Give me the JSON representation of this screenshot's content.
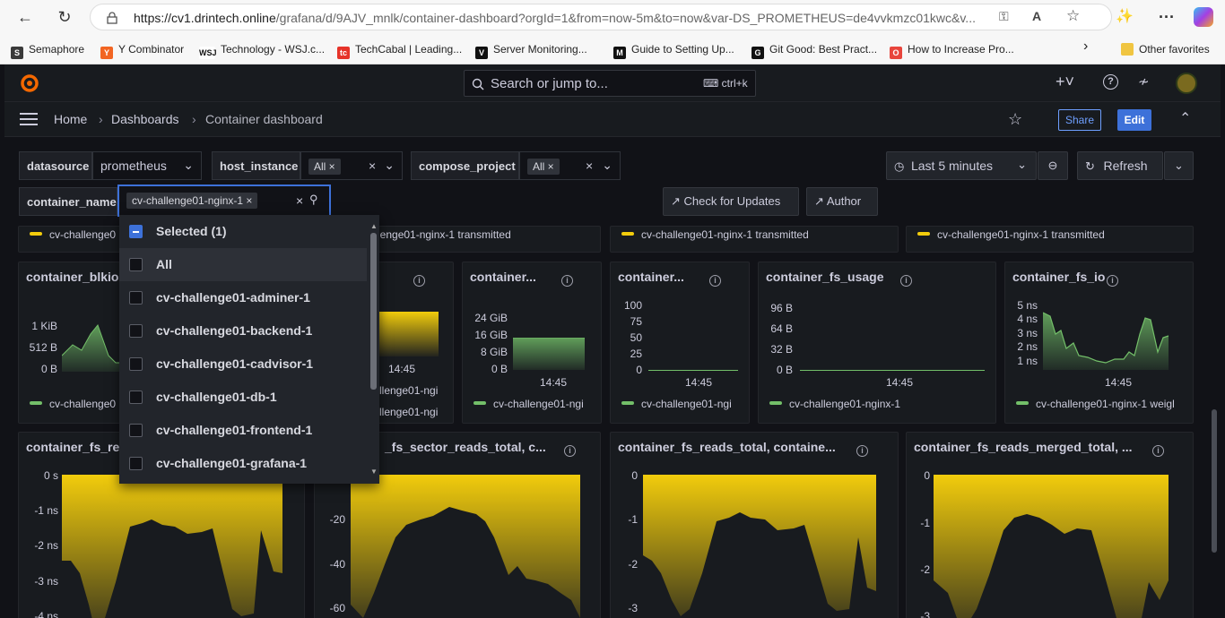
{
  "browser": {
    "url_host": "https://cv1.drintech.online",
    "url_rest": "/grafana/d/9AJV_mnlk/container-dashboard?orgId=1&from=now-5m&to=now&var-DS_PROMETHEUS=de4vvkmzc01kwc&v...",
    "bookmarks": [
      {
        "label": "Semaphore",
        "color": "#3a3a3a",
        "glyph": "S"
      },
      {
        "label": "Y Combinator",
        "color": "#f26522",
        "glyph": "Y"
      },
      {
        "label": "Technology - WSJ.c...",
        "color": "#111111",
        "glyph": "W"
      },
      {
        "label": "TechCabal | Leading...",
        "color": "#e63329",
        "glyph": "tc"
      },
      {
        "label": "Server Monitoring...",
        "color": "#111111",
        "glyph": "V"
      },
      {
        "label": "Guide to Setting Up...",
        "color": "#111111",
        "glyph": "M"
      },
      {
        "label": "Git Good: Best Pract...",
        "color": "#111111",
        "glyph": "G"
      },
      {
        "label": "How to Increase Pro...",
        "color": "#e8453c",
        "glyph": "O"
      }
    ],
    "other_favorites": "Other favorites"
  },
  "topbar": {
    "search_placeholder": "Search or jump to...",
    "shortcut": "ctrl+k"
  },
  "breadcrumb": {
    "home": "Home",
    "dashboards": "Dashboards",
    "current": "Container dashboard"
  },
  "actions": {
    "share": "Share",
    "edit": "Edit"
  },
  "variables": {
    "datasource": {
      "label": "datasource",
      "value": "prometheus"
    },
    "host_instance": {
      "label": "host_instance",
      "value": "All"
    },
    "compose_project": {
      "label": "compose_project",
      "value": "All"
    },
    "container_name": {
      "label": "container_name",
      "value": "cv-challenge01-nginx-1"
    }
  },
  "time_range": "Last 5 minutes",
  "refresh": "Refresh",
  "links": {
    "check_updates": "Check for Updates",
    "author": "Author"
  },
  "dropdown": {
    "selected_header": "Selected (1)",
    "options": [
      "All",
      "cv-challenge01-adminer-1",
      "cv-challenge01-backend-1",
      "cv-challenge01-cadvisor-1",
      "cv-challenge01-db-1",
      "cv-challenge01-frontend-1",
      "cv-challenge01-grafana-1"
    ]
  },
  "top_legends": {
    "p1": "cv-challenge0",
    "p2": "lenge01-nginx-1 transmitted",
    "p3": "cv-challenge01-nginx-1 transmitted",
    "p4": "cv-challenge01-nginx-1 transmitted"
  },
  "row2": {
    "p1": {
      "title": "container_blkio",
      "y": [
        "1 KiB",
        "512 B",
        "0 B"
      ],
      "legend": "cv-challenge0"
    },
    "p2": {
      "x": "14:45",
      "legend_a": "llenge01-ngi",
      "legend_b": "llenge01-ngi"
    },
    "p3": {
      "title": "container...",
      "y": [
        "24 GiB",
        "16 GiB",
        "8 GiB",
        "0 B"
      ],
      "x": "14:45",
      "legend": "cv-challenge01-ngi"
    },
    "p4": {
      "title": "container...",
      "y": [
        "100",
        "75",
        "50",
        "25",
        "0"
      ],
      "x": "14:45",
      "legend": "cv-challenge01-ngi"
    },
    "p5": {
      "title": "container_fs_usage",
      "y": [
        "96 B",
        "64 B",
        "32 B",
        "0 B"
      ],
      "x": "14:45",
      "legend": "cv-challenge01-nginx-1"
    },
    "p6": {
      "title": "container_fs_io",
      "y": [
        "5 ns",
        "4 ns",
        "3 ns",
        "2 ns",
        "1 ns"
      ],
      "x": "14:45",
      "legend": "cv-challenge01-nginx-1 weigl"
    }
  },
  "row3": {
    "p1": {
      "title": "container_fs_re",
      "y": [
        "0 s",
        "-1 ns",
        "-2 ns",
        "-3 ns",
        "-4 ns"
      ]
    },
    "p2": {
      "title": "_fs_sector_reads_total, c...",
      "y": [
        "-20",
        "-40",
        "-60"
      ]
    },
    "p3": {
      "title": "container_fs_reads_total, containe...",
      "y": [
        "0",
        "-1",
        "-2",
        "-3"
      ]
    },
    "p4": {
      "title": "container_fs_reads_merged_total, ...",
      "y": [
        "0",
        "-1",
        "-2",
        "-3"
      ]
    }
  },
  "colors": {
    "accent": "#3d71d9",
    "yellow": "#f2cc0c",
    "green": "#73bf69",
    "bg": "#111217",
    "panel": "#181b1f"
  }
}
